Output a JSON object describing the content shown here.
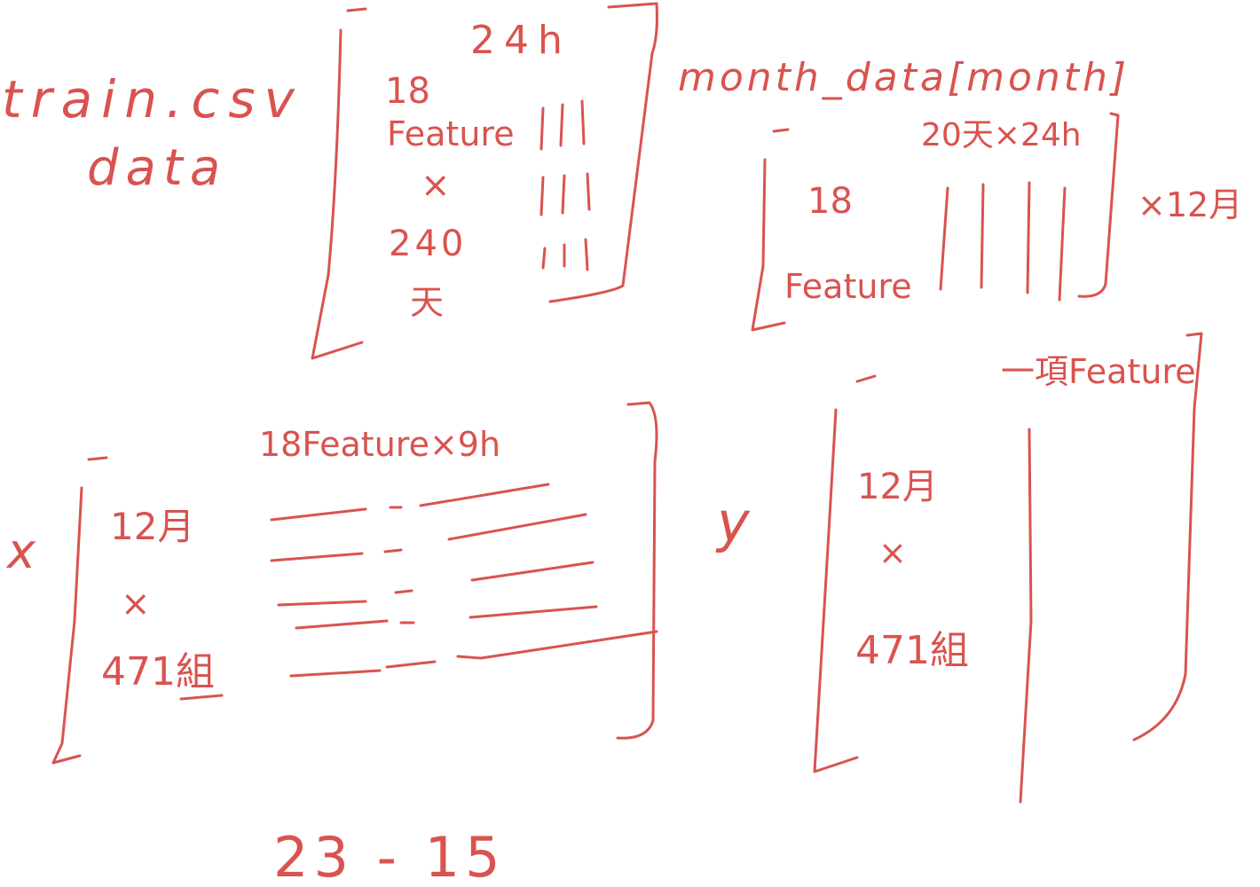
{
  "ink_color": "#d9534f",
  "top_left": {
    "file_label": "train.csv",
    "var_label": "data",
    "matrix": {
      "col_header": "24h",
      "row_count": "18",
      "row_name": "Feature",
      "times": "×",
      "days_count": "240",
      "days_unit": "天"
    }
  },
  "top_right": {
    "title": "month_data[month]",
    "matrix": {
      "col_header": "20天×24h",
      "row_count": "18",
      "row_name": "Feature"
    },
    "multiplier": "×12月"
  },
  "bottom_left": {
    "var": "x",
    "matrix": {
      "col_header": "18Feature×9h",
      "months": "12月",
      "times": "×",
      "groups": "471組"
    }
  },
  "bottom_right": {
    "var": "y",
    "matrix": {
      "col_header": "一項Feature",
      "months": "12月",
      "times": "×",
      "groups": "471組"
    }
  },
  "footer": "23 - 15"
}
